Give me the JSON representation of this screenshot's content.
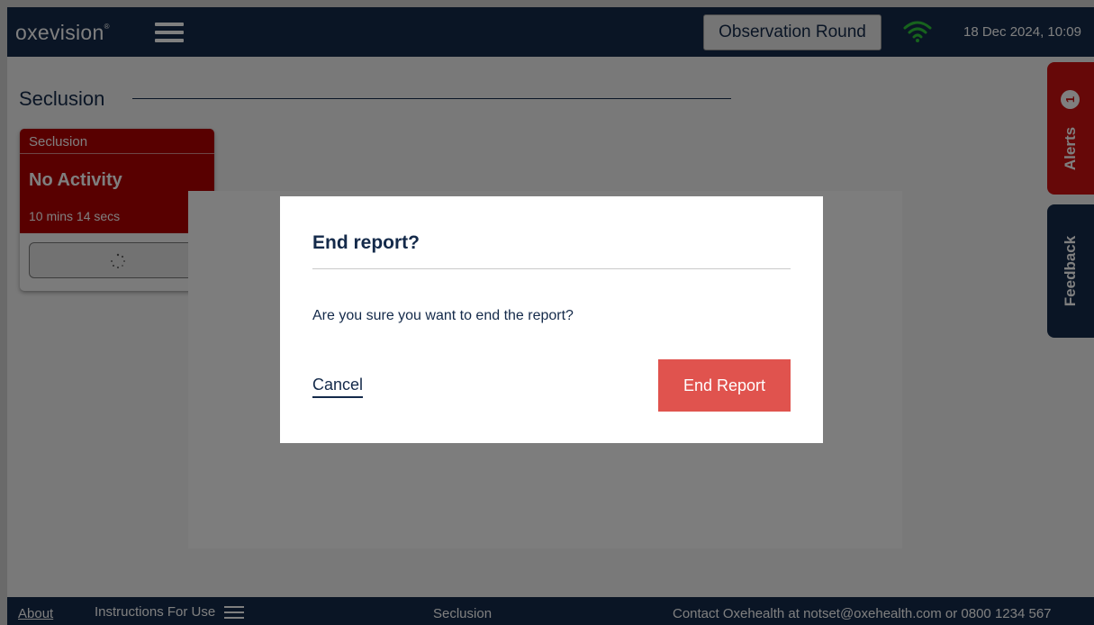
{
  "header": {
    "logo_text": "oxevision",
    "logo_mark": "®",
    "menu_icon": "hamburger-icon",
    "observation_button": "Observation Round",
    "wifi_icon": "wifi-icon",
    "datetime": "18 Dec 2024, 10:09"
  },
  "page": {
    "title": "Seclusion"
  },
  "card": {
    "room": "Seclusion",
    "status": "No Activity",
    "duration": "10 mins 14 secs",
    "button_icon": "loading-spinner-icon",
    "status_color": "#b00000"
  },
  "side_tabs": {
    "alerts_label": "Alerts",
    "alerts_count": "1",
    "feedback_label": "Feedback"
  },
  "footer": {
    "about": "About",
    "instructions": "Instructions For Use",
    "room": "Seclusion",
    "contact": "Contact Oxehealth at notset@oxehealth.com or 0800 1234 567"
  },
  "modal": {
    "title": "End report?",
    "message": "Are you sure you want to end the report?",
    "cancel_label": "Cancel",
    "confirm_label": "End Report",
    "confirm_color": "#e0534e"
  },
  "colors": {
    "navy": "#142a4a",
    "alert_red": "#cc1010"
  }
}
